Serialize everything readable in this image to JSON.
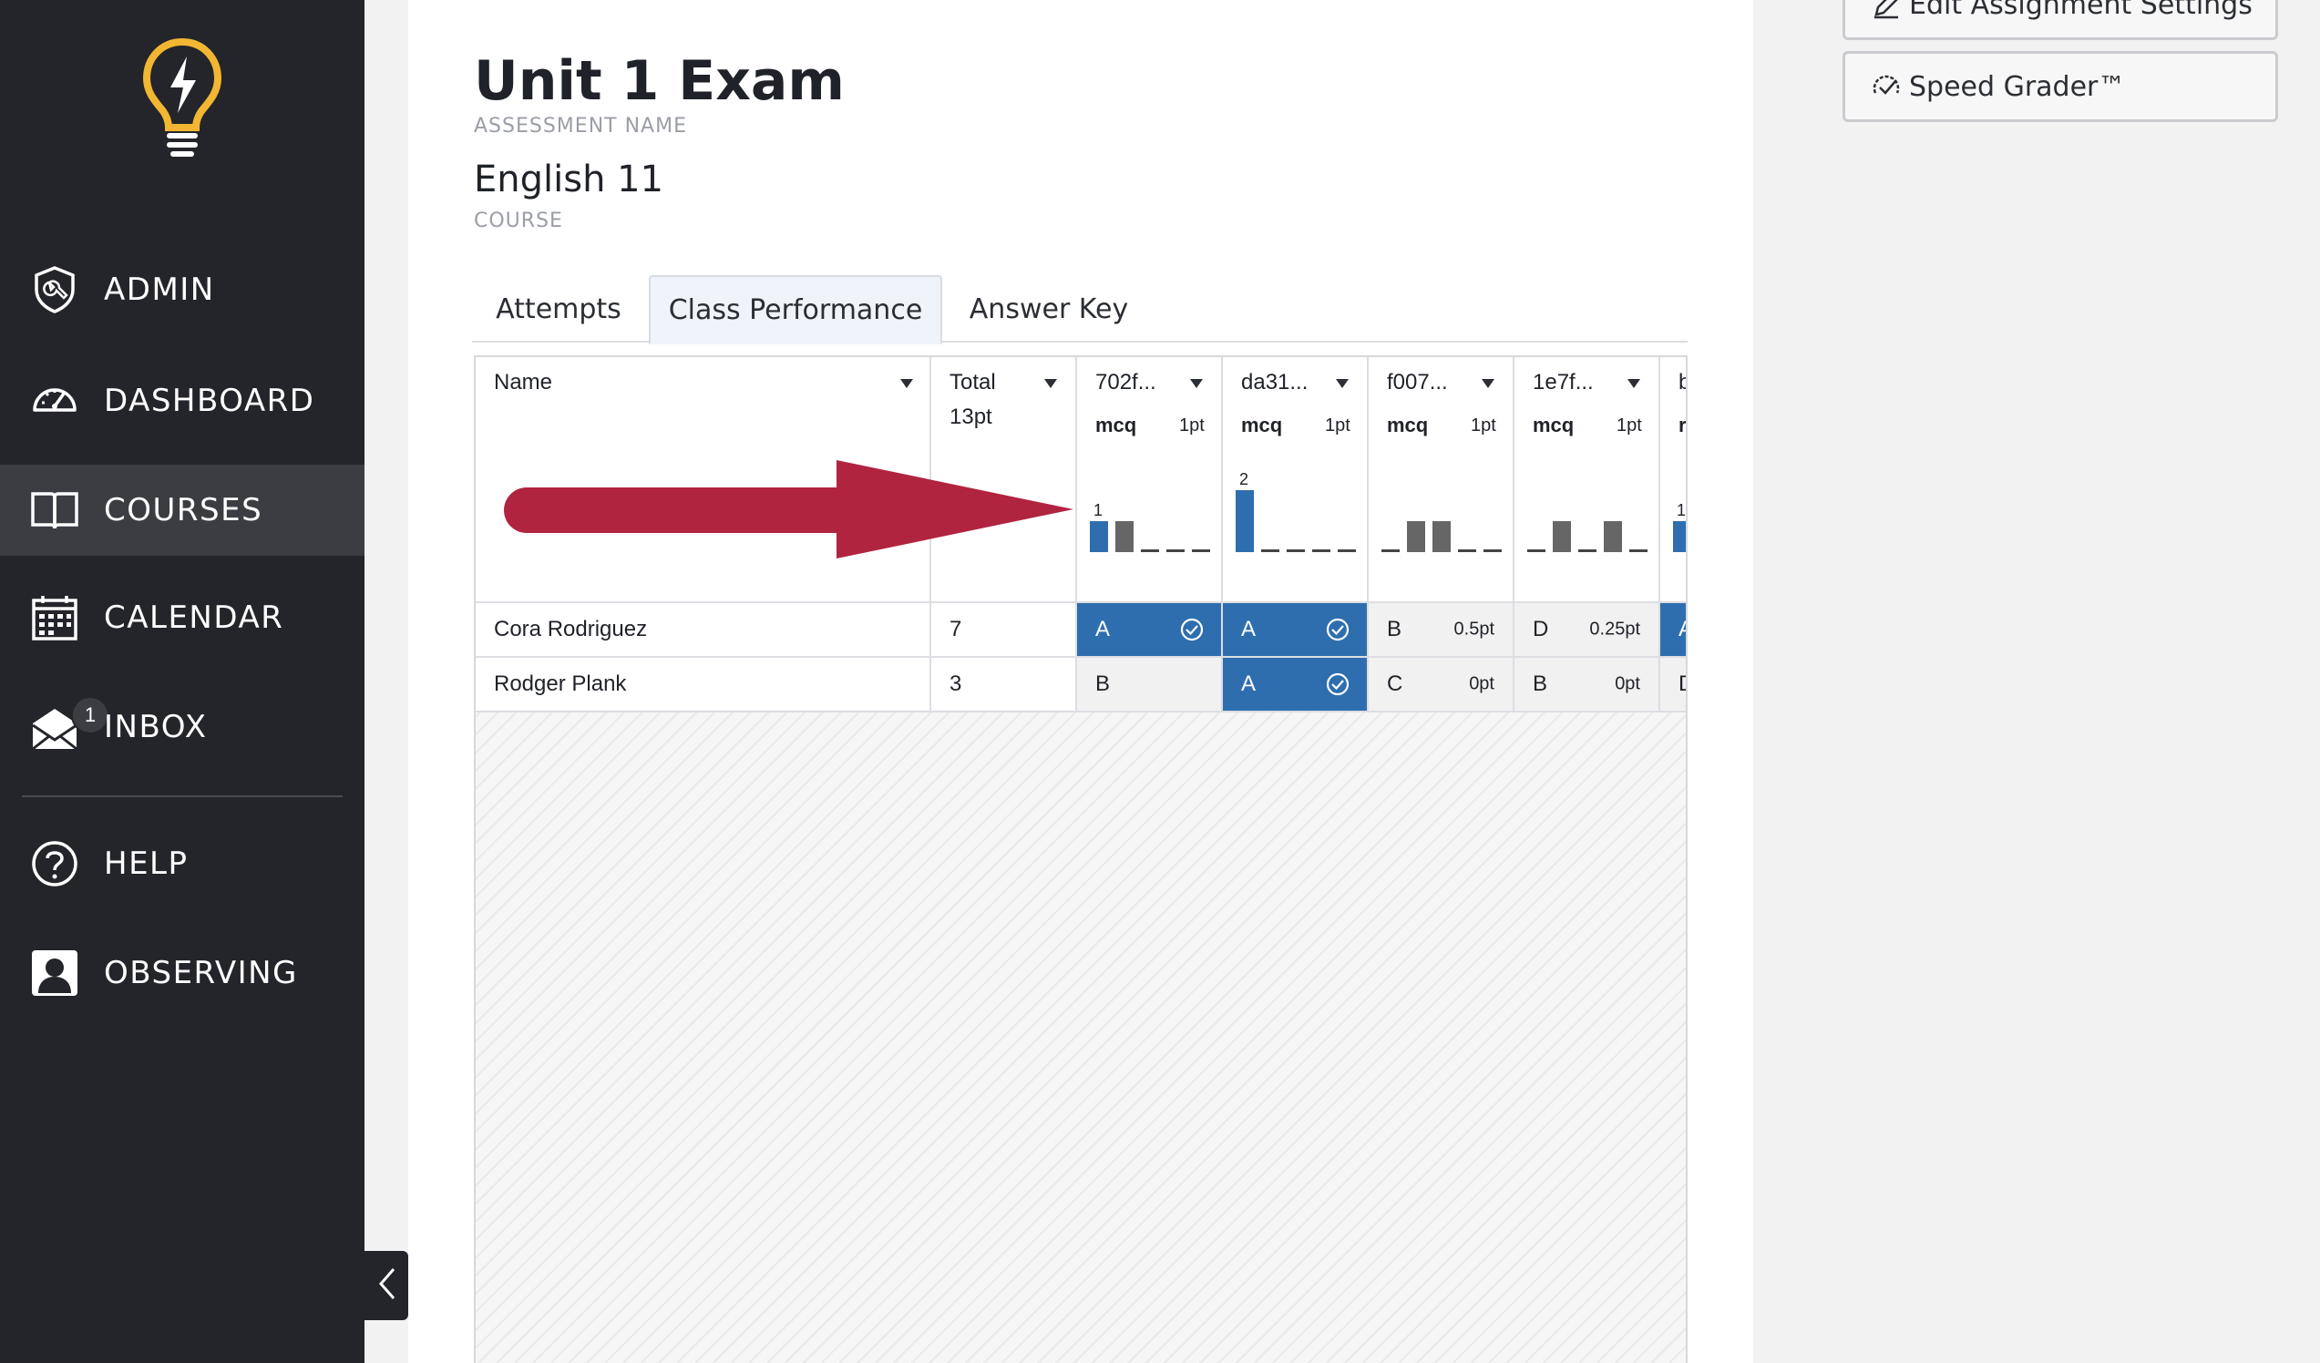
{
  "sidebar": {
    "items": [
      {
        "label": "ADMIN",
        "icon": "admin-shield-wrench-icon"
      },
      {
        "label": "DASHBOARD",
        "icon": "speedometer-icon"
      },
      {
        "label": "COURSES",
        "icon": "open-book-icon",
        "active": true
      },
      {
        "label": "CALENDAR",
        "icon": "calendar-icon"
      },
      {
        "label": "INBOX",
        "icon": "envelope-icon",
        "badge": "1"
      },
      {
        "label": "HELP",
        "icon": "question-circle-icon"
      },
      {
        "label": "OBSERVING",
        "icon": "person-silhouette-icon"
      }
    ]
  },
  "header": {
    "assessment_name": "Unit 1 Exam",
    "assessment_caption": "ASSESSMENT NAME",
    "course_name": "English 11",
    "course_caption": "COURSE"
  },
  "tabs": [
    {
      "label": "Attempts"
    },
    {
      "label": "Class Performance",
      "active": true
    },
    {
      "label": "Answer Key"
    }
  ],
  "grid": {
    "name_header": "Name",
    "total_header": "Total",
    "total_points": "13pt",
    "questions": [
      {
        "id": "702f...",
        "type": "mcq",
        "points": "1pt",
        "distribution": [
          1,
          1,
          0,
          0,
          0
        ],
        "peak_label": "1"
      },
      {
        "id": "da31...",
        "type": "mcq",
        "points": "1pt",
        "distribution": [
          2,
          0,
          0,
          0,
          0
        ],
        "peak_label": "2"
      },
      {
        "id": "f007...",
        "type": "mcq",
        "points": "1pt",
        "distribution": [
          0,
          1,
          1,
          0,
          0
        ]
      },
      {
        "id": "1e7f...",
        "type": "mcq",
        "points": "1pt",
        "distribution": [
          0,
          1,
          0,
          1,
          0
        ]
      },
      {
        "id": "b",
        "type": "r",
        "points": "",
        "distribution": [
          1
        ],
        "peak_label": "1"
      }
    ],
    "rows": [
      {
        "name": "Cora Rodriguez",
        "total": "7",
        "cells": [
          {
            "answer": "A",
            "correct": true,
            "points": ""
          },
          {
            "answer": "A",
            "correct": true,
            "points": ""
          },
          {
            "answer": "B",
            "correct": false,
            "points": "0.5pt"
          },
          {
            "answer": "D",
            "correct": false,
            "points": "0.25pt"
          },
          {
            "answer": "A",
            "correct": true,
            "points": ""
          }
        ]
      },
      {
        "name": "Rodger Plank",
        "total": "3",
        "cells": [
          {
            "answer": "B",
            "correct": false,
            "points": ""
          },
          {
            "answer": "A",
            "correct": true,
            "points": ""
          },
          {
            "answer": "C",
            "correct": false,
            "points": "0pt"
          },
          {
            "answer": "B",
            "correct": false,
            "points": "0pt"
          },
          {
            "answer": "D",
            "correct": false,
            "points": ""
          }
        ]
      }
    ]
  },
  "actions": {
    "edit_settings_label": "Edit Assignment Settings",
    "speed_grader_label": "Speed Grader™"
  },
  "colors": {
    "sidebar_bg": "#24252a",
    "sidebar_active": "#3b3d43",
    "correct_blue": "#2f6eae",
    "bar_gray": "#666666",
    "arrow_red": "#b0243f",
    "logo_yellow": "#f2b632"
  }
}
